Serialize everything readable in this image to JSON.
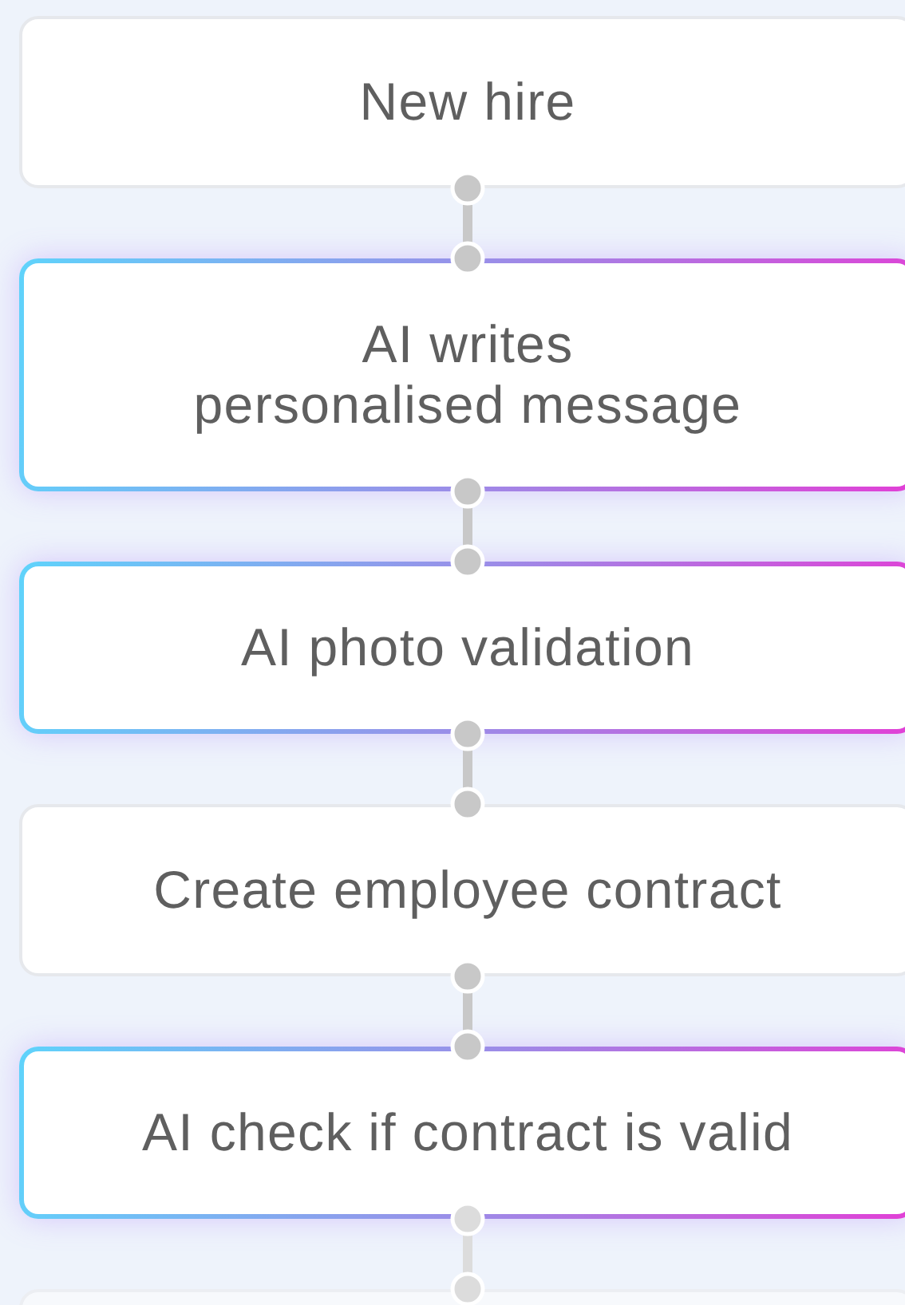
{
  "steps": [
    {
      "text": "New hire",
      "kind": "plain"
    },
    {
      "text": "AI writes\npersonalised message",
      "kind": "ai"
    },
    {
      "text": "AI photo validation",
      "kind": "ai"
    },
    {
      "text": "Create employee contract",
      "kind": "plain"
    },
    {
      "text": "AI check if contract is valid",
      "kind": "ai"
    }
  ]
}
